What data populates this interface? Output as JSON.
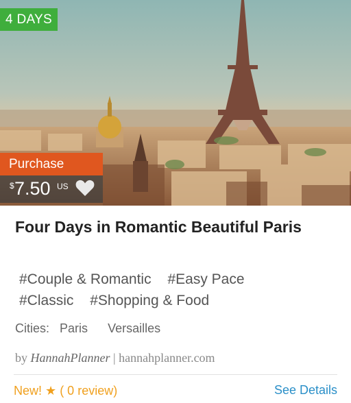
{
  "badge": {
    "days": "4 DAYS"
  },
  "purchase": {
    "label": "Purchase",
    "currency_symbol": "$",
    "price": "7.50",
    "currency_unit": "US"
  },
  "trip": {
    "title": "Four Days in Romantic Beautiful Paris",
    "tags": [
      [
        "#Couple & Romantic",
        "#Easy Pace"
      ],
      [
        "#Classic",
        "#Shopping & Food"
      ]
    ],
    "cities_label": "Cities:",
    "cities": [
      "Paris",
      "Versailles"
    ],
    "by_prefix": "by",
    "author": "HannahPlanner",
    "separator": "|",
    "site": "hannahplanner.com"
  },
  "footer": {
    "new_label": "New!",
    "star": "★",
    "review_text": "( 0 review)",
    "see_details": "See Details"
  },
  "colors": {
    "badge_green": "#3fae3c",
    "purchase_orange": "#e0571f",
    "rating_orange": "#f0a01e",
    "link_blue": "#2a8fc8"
  },
  "icons": {
    "favorite": "heart-icon",
    "rating": "star-icon"
  }
}
